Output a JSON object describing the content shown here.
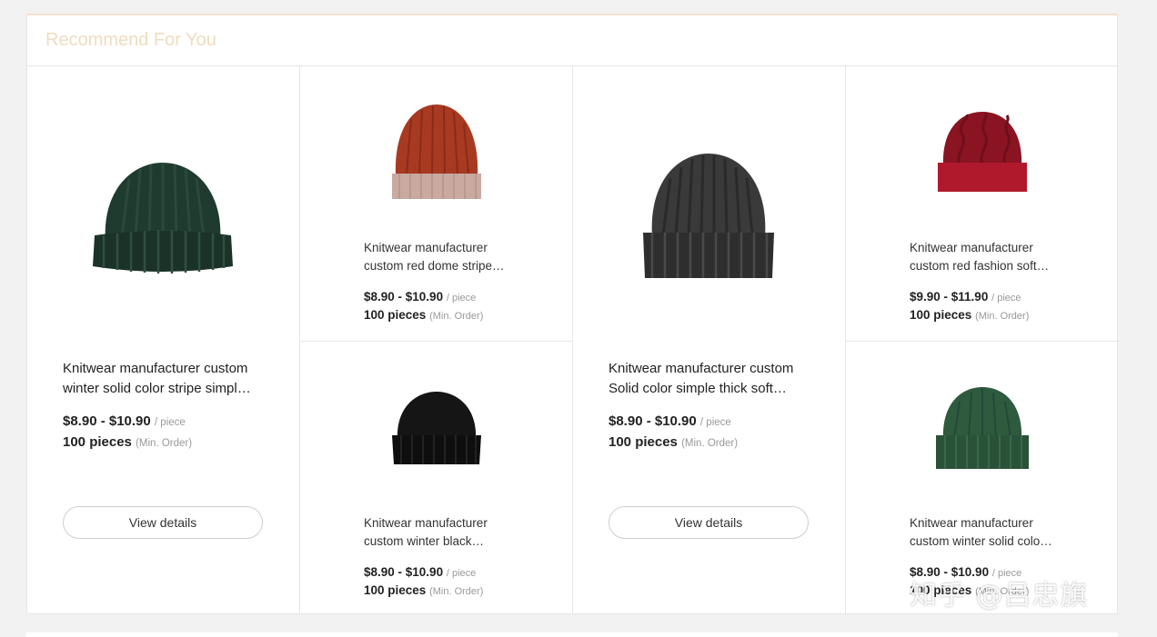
{
  "section": {
    "title": "Recommend For You"
  },
  "products": [
    {
      "title_line1": "Knitwear manufacturer custom",
      "title_line2": "winter solid color stripe simpl…",
      "price": "$8.90 - $10.90",
      "price_unit": "/ piece",
      "moq": "100 pieces",
      "moq_note": "(Min. Order)",
      "button": "View details",
      "hat_color": "#1f3a2e",
      "hat_type": "green-knit-beanie"
    },
    {
      "title_line1": "Knitwear manufacturer",
      "title_line2": "custom red dome stripe…",
      "price": "$8.90 - $10.90",
      "price_unit": "/ piece",
      "moq": "100 pieces",
      "moq_note": "(Min. Order)",
      "hat_color": "#a83a22",
      "cuff_color": "#c9a9a0",
      "hat_type": "red-dome-beanie"
    },
    {
      "title_line1": "Knitwear manufacturer",
      "title_line2": "custom winter black…",
      "price": "$8.90 - $10.90",
      "price_unit": "/ piece",
      "moq": "100 pieces",
      "moq_note": "(Min. Order)",
      "hat_color": "#151515",
      "hat_type": "black-beanie"
    },
    {
      "title_line1": "Knitwear manufacturer custom",
      "title_line2": "Solid color simple thick soft…",
      "price": "$8.90 - $10.90",
      "price_unit": "/ piece",
      "moq": "100 pieces",
      "moq_note": "(Min. Order)",
      "button": "View details",
      "hat_color": "#3a3a3a",
      "hat_type": "dark-grey-beanie"
    },
    {
      "title_line1": "Knitwear manufacturer",
      "title_line2": "custom red fashion soft…",
      "price": "$9.90 - $11.90",
      "price_unit": "/ piece",
      "moq": "100 pieces",
      "moq_note": "(Min. Order)",
      "hat_color": "#b0192b",
      "hat_type": "red-cable-beanie"
    },
    {
      "title_line1": "Knitwear manufacturer",
      "title_line2": "custom winter solid colo…",
      "price": "$8.90 - $10.90",
      "price_unit": "/ piece",
      "moq": "100 pieces",
      "moq_note": "(Min. Order)",
      "hat_color": "#2e5a3e",
      "hat_type": "green-beanie"
    }
  ],
  "watermark": "知乎 @吕忠旗"
}
